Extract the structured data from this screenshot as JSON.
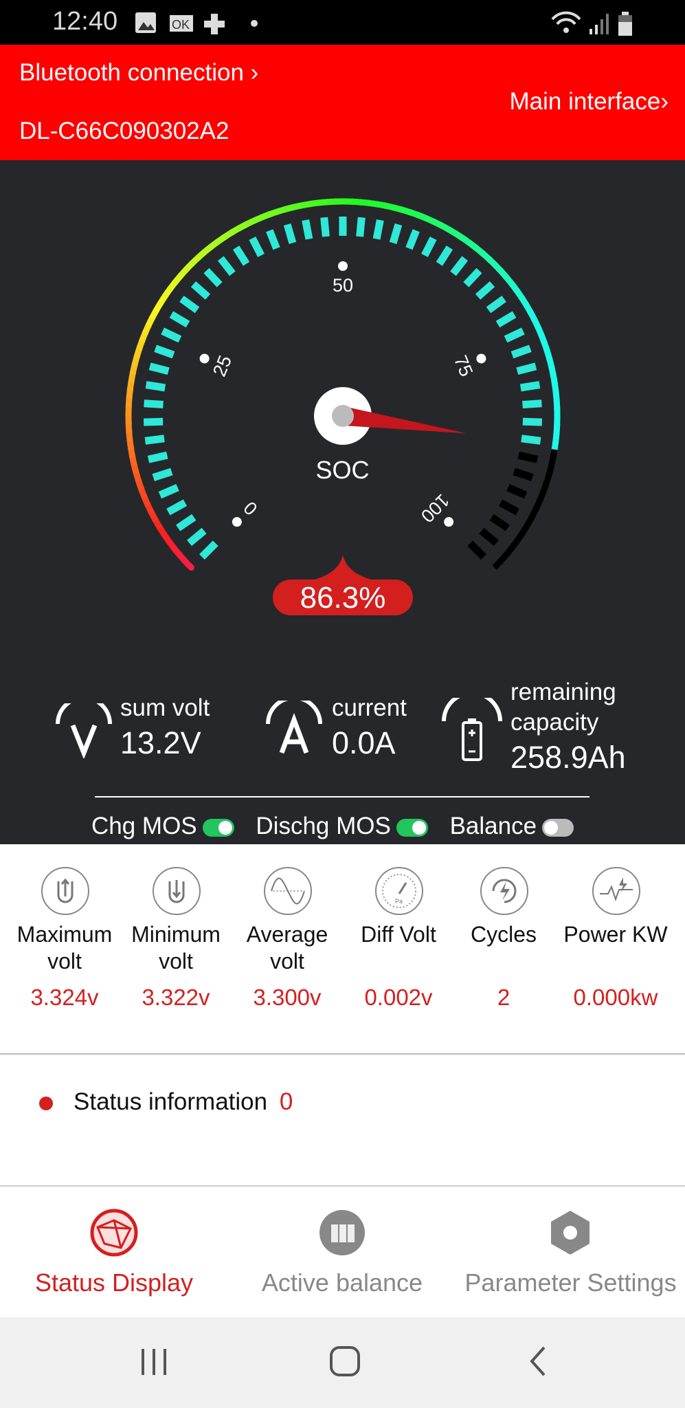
{
  "status_bar": {
    "time": "12:40"
  },
  "header": {
    "bluetooth_label": "Bluetooth connection",
    "device_id": "DL-C66C090302A2",
    "main_interface_label": "Main interface",
    "chevron": "›"
  },
  "gauge": {
    "soc_label": "SOC",
    "soc_value": 86.3,
    "soc_text": "86.3%",
    "scale_labels": [
      "0",
      "25",
      "50",
      "75",
      "100"
    ],
    "colors": {
      "tick_active": "#2ee8d8",
      "tick_inactive": "#000000",
      "needle": "#c4161c",
      "badge": "#d41f1f"
    }
  },
  "stats": [
    {
      "label": "sum volt",
      "value": "13.2V",
      "icon": "volt-icon"
    },
    {
      "label": "current",
      "value": "0.0A",
      "icon": "current-icon"
    },
    {
      "label": "remaining capacity",
      "value": "258.9Ah",
      "icon": "battery-icon"
    }
  ],
  "toggles": [
    {
      "label": "Chg MOS",
      "on": true
    },
    {
      "label": "Dischg MOS",
      "on": true
    },
    {
      "label": "Balance",
      "on": false
    }
  ],
  "metrics": [
    {
      "label": "Maximum volt",
      "value": "3.324v",
      "icon": "max-volt-icon"
    },
    {
      "label": "Minimum volt",
      "value": "3.322v",
      "icon": "min-volt-icon"
    },
    {
      "label": "Average volt",
      "value": "3.300v",
      "icon": "sine-wave-icon"
    },
    {
      "label": "Diff Volt",
      "value": "0.002v",
      "icon": "pressure-gauge-icon"
    },
    {
      "label": "Cycles",
      "value": "2",
      "icon": "cycle-bolt-icon"
    },
    {
      "label": "Power KW",
      "value": "0.000kw",
      "icon": "power-pulse-icon"
    }
  ],
  "status_info": {
    "label": "Status information",
    "count": "0"
  },
  "bottom_nav": [
    {
      "label": "Status Display",
      "active": true
    },
    {
      "label": "Active balance",
      "active": false
    },
    {
      "label": "Parameter Settings",
      "active": false
    }
  ],
  "accent": "#fe0000"
}
